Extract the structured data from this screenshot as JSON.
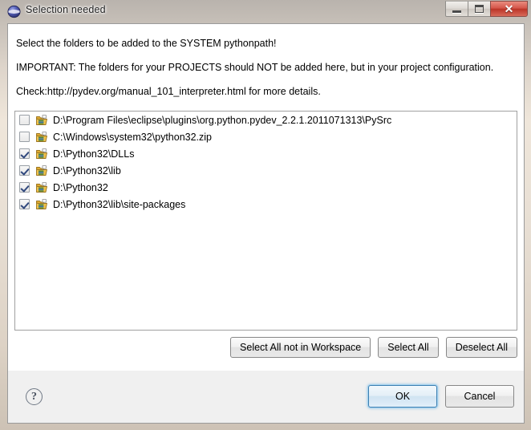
{
  "window": {
    "title": "Selection needed",
    "icon": "eclipse-icon",
    "controls": {
      "minimize": "minimize-button",
      "restore": "restore-button",
      "close": "✕"
    }
  },
  "dialog": {
    "messages": [
      "Select the folders to be added to the SYSTEM pythonpath!",
      "IMPORTANT: The folders for your PROJECTS should NOT be added here, but in your project configuration.",
      "Check:http://pydev.org/manual_101_interpreter.html for more details."
    ],
    "list_items": [
      {
        "checked": false,
        "path": "D:\\Program Files\\eclipse\\plugins\\org.python.pydev_2.2.1.2011071313\\PySrc"
      },
      {
        "checked": false,
        "path": "C:\\Windows\\system32\\python32.zip"
      },
      {
        "checked": true,
        "path": "D:\\Python32\\DLLs"
      },
      {
        "checked": true,
        "path": "D:\\Python32\\lib"
      },
      {
        "checked": true,
        "path": "D:\\Python32"
      },
      {
        "checked": true,
        "path": "D:\\Python32\\lib\\site-packages"
      }
    ],
    "selection_buttons": [
      "Select All not in Workspace",
      "Select All",
      "Deselect All"
    ],
    "footer": {
      "help": "?",
      "ok": "OK",
      "cancel": "Cancel"
    }
  },
  "colors": {
    "frame": "#e8dfd4",
    "body": "#ffffff",
    "footer": "#f0f0f0",
    "close_button": "#c4402f",
    "focus_glow": "#5aaae1",
    "check_mark": "#31497e"
  }
}
